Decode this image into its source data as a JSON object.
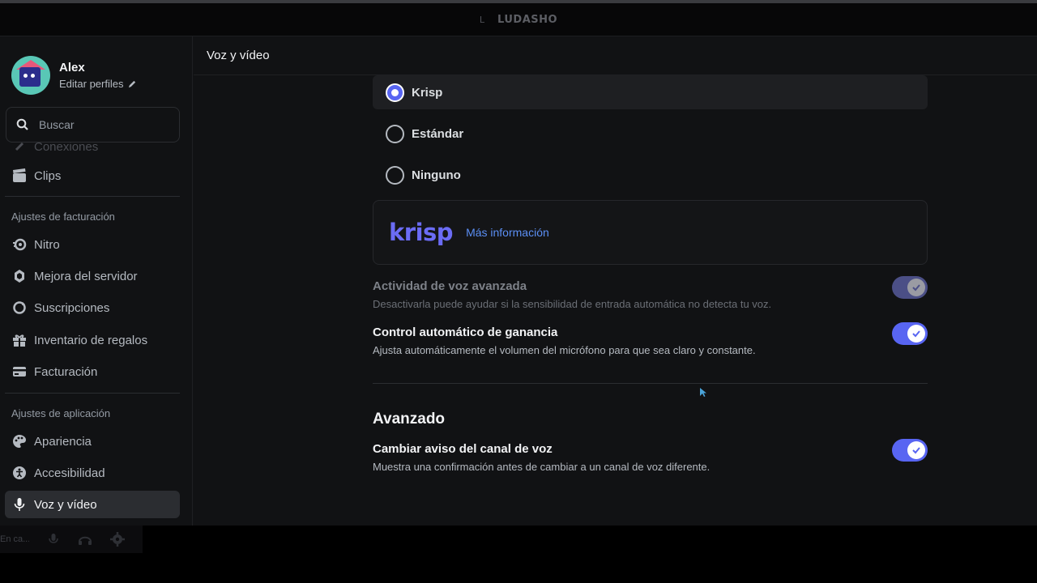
{
  "window": {
    "title": "LUDASHO",
    "logo_glyph": "L"
  },
  "profile": {
    "name": "Alex",
    "edit_label": "Editar perfiles"
  },
  "search": {
    "placeholder": "Buscar"
  },
  "sidebar": {
    "partial_item": "Conexiones",
    "clips_label": "Clips",
    "billing_header": "Ajustes de facturación",
    "billing_items": [
      {
        "label": "Nitro",
        "icon": "nitro-icon"
      },
      {
        "label": "Mejora del servidor",
        "icon": "server-boost-icon"
      },
      {
        "label": "Suscripciones",
        "icon": "subscriptions-icon"
      },
      {
        "label": "Inventario de regalos",
        "icon": "gift-icon"
      },
      {
        "label": "Facturación",
        "icon": "credit-card-icon"
      }
    ],
    "app_header": "Ajustes de aplicación",
    "app_items": [
      {
        "label": "Apariencia",
        "icon": "palette-icon"
      },
      {
        "label": "Accesibilidad",
        "icon": "accessibility-icon"
      },
      {
        "label": "Voz y vídeo",
        "icon": "microphone-icon"
      }
    ]
  },
  "content": {
    "header_title": "Voz y vídeo",
    "noise_options": [
      "Krisp",
      "Estándar",
      "Ninguno"
    ],
    "noise_selected": "Krisp",
    "krisp": {
      "logo": "krisp",
      "link": "Más información"
    },
    "settings": [
      {
        "title": "Actividad de voz avanzada",
        "desc": "Desactivarla puede ayudar si la sensibilidad de entrada automática no detecta tu voz.",
        "enabled": true,
        "disabled": true
      },
      {
        "title": "Control automático de ganancia",
        "desc": "Ajusta automáticamente el volumen del micrófono para que sea claro y constante.",
        "enabled": true,
        "disabled": false
      }
    ],
    "advanced": {
      "title": "Avanzado",
      "settings": [
        {
          "title": "Cambiar aviso del canal de voz",
          "desc": "Muestra una confirmación antes de cambiar a un canal de voz diferente.",
          "enabled": true
        }
      ]
    }
  },
  "user_panel": {
    "status": "En ca..."
  },
  "colors": {
    "accent": "#5865f2",
    "background": "#111214",
    "link": "#5b8ff5",
    "krisp": "#6b6cf5"
  }
}
